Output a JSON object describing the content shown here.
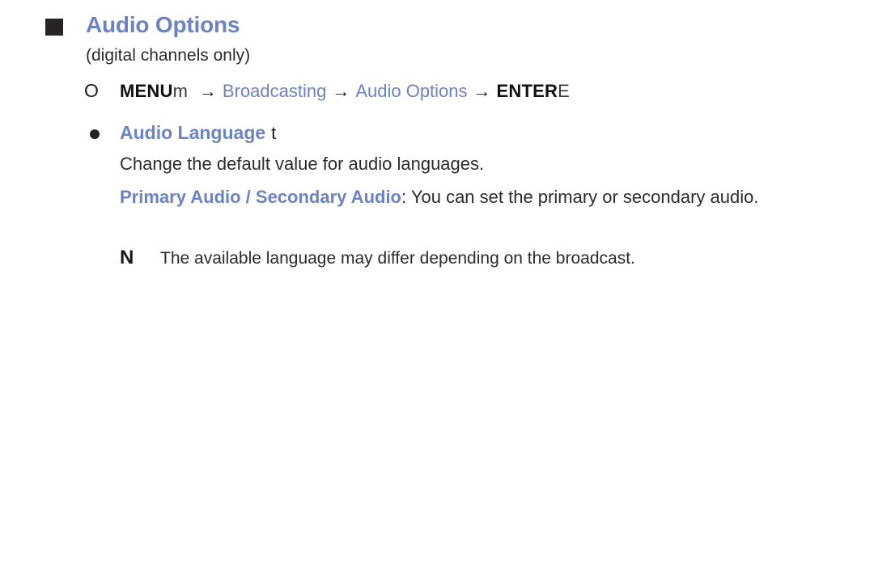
{
  "page": {
    "background_color": "#ffffff",
    "accent_color": "#6b82c4",
    "text_color": "#2b2b2b",
    "marker_color": "#272425"
  },
  "section": {
    "marker": "filled-square",
    "title": "Audio Options",
    "subtitle": "(digital channels only)"
  },
  "menu_path": {
    "marker": "O",
    "steps": [
      {
        "label": "MENU",
        "key_glyph": "m",
        "style": "bold-black"
      },
      {
        "label": "Broadcasting",
        "style": "blue"
      },
      {
        "label": "Audio Options",
        "style": "blue"
      },
      {
        "label": "ENTER",
        "key_glyph": "E",
        "style": "bold-black"
      }
    ],
    "arrow": "→"
  },
  "option": {
    "marker": "filled-circle",
    "label": "Audio Language",
    "key_glyph": "t",
    "description": "Change the default value for audio languages.",
    "setting": {
      "name": "Primary Audio / Secondary Audio",
      "separator": ": ",
      "detail": "You can set the primary or secondary audio."
    },
    "note": {
      "marker": "N",
      "text": "The available language may differ depending on the broadcast."
    }
  }
}
